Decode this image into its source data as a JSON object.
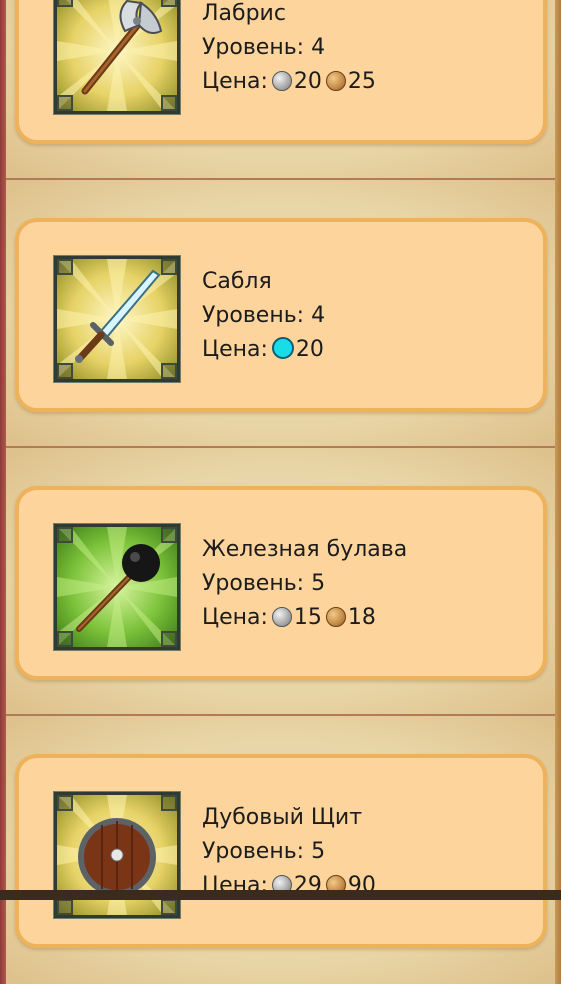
{
  "items": [
    {
      "name": "Лабрис",
      "level_label": "Уровень: 4",
      "price_label": "Цена:",
      "price": [
        {
          "coin": "silver-coin",
          "amount": "20"
        },
        {
          "coin": "bronze-coin",
          "amount": "25"
        }
      ],
      "icon": "double-axe-icon",
      "bg": "yellow-rays"
    },
    {
      "name": "Сабля",
      "level_label": "Уровень: 4",
      "price_label": "Цена:",
      "price": [
        {
          "coin": "gem-coin",
          "amount": "20"
        }
      ],
      "icon": "sword-icon",
      "bg": "yellow-rays"
    },
    {
      "name": "Железная булава",
      "level_label": "Уровень: 5",
      "price_label": "Цена:",
      "price": [
        {
          "coin": "silver-coin",
          "amount": "15"
        },
        {
          "coin": "bronze-coin",
          "amount": "18"
        }
      ],
      "icon": "mace-icon",
      "bg": "green-rays"
    },
    {
      "name": "Дубовый Щит",
      "level_label": "Уровень: 5",
      "price_label": "Цена:",
      "price": [
        {
          "coin": "silver-coin",
          "amount": "29"
        },
        {
          "coin": "bronze-coin",
          "amount": "90"
        }
      ],
      "icon": "wooden-shield-icon",
      "bg": "yellow-rays"
    }
  ],
  "colors": {
    "card_bg": "#fdd49c",
    "card_border": "#eeb25a",
    "text": "#1c1c1c",
    "gem": "#18dce8"
  }
}
